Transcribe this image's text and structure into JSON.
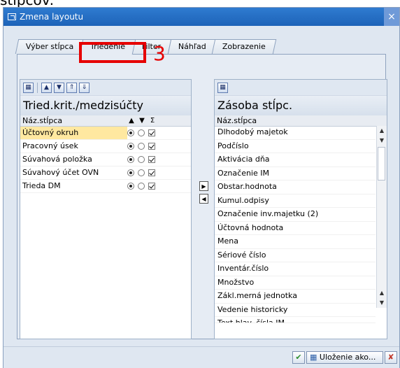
{
  "page_top_text": "stĺpcov:",
  "window": {
    "title": "Zmena layoutu",
    "close_glyph": "×"
  },
  "tabs": [
    {
      "label": "Výber stĺpca",
      "active": false
    },
    {
      "label": "Triedenie",
      "active": true
    },
    {
      "label": "Filter",
      "active": false
    },
    {
      "label": "Náhľad",
      "active": false
    },
    {
      "label": "Zobrazenie",
      "active": false
    }
  ],
  "annotation": {
    "step_number": "3",
    "color": "#e60000"
  },
  "left_panel": {
    "title": "Tried.krit./medzisúčty",
    "column_header": "Náz.stĺpca",
    "rows": [
      {
        "name": "Účtovný okruh",
        "asc": true,
        "desc": false,
        "subtotal": true,
        "selected": true
      },
      {
        "name": "Pracovný úsek",
        "asc": true,
        "desc": false,
        "subtotal": true,
        "selected": false
      },
      {
        "name": "Súvahová položka",
        "asc": true,
        "desc": false,
        "subtotal": true,
        "selected": false
      },
      {
        "name": "Súvahový účet OVN",
        "asc": true,
        "desc": false,
        "subtotal": true,
        "selected": false
      },
      {
        "name": "Trieda DM",
        "asc": true,
        "desc": false,
        "subtotal": true,
        "selected": false
      }
    ]
  },
  "right_panel": {
    "title": "Zásoba stĺpc.",
    "column_header": "Náz.stĺpca",
    "rows": [
      "Dlhodobý majetok",
      "Podčíslo",
      "Aktivácia dňa",
      "Označenie IM",
      "Obstar.hodnota",
      "Kumul.odpisy",
      "Označenie inv.majetku (2)",
      "Účtovná hodnota",
      "Mena",
      "Sériové číslo",
      "Inventár.číslo",
      "Množstvo",
      "Zákl.merná jednotka",
      "Vedenie historicky",
      "Text hlav. čísla IM"
    ]
  },
  "footer": {
    "save_as_label": "Uloženie ako..."
  }
}
